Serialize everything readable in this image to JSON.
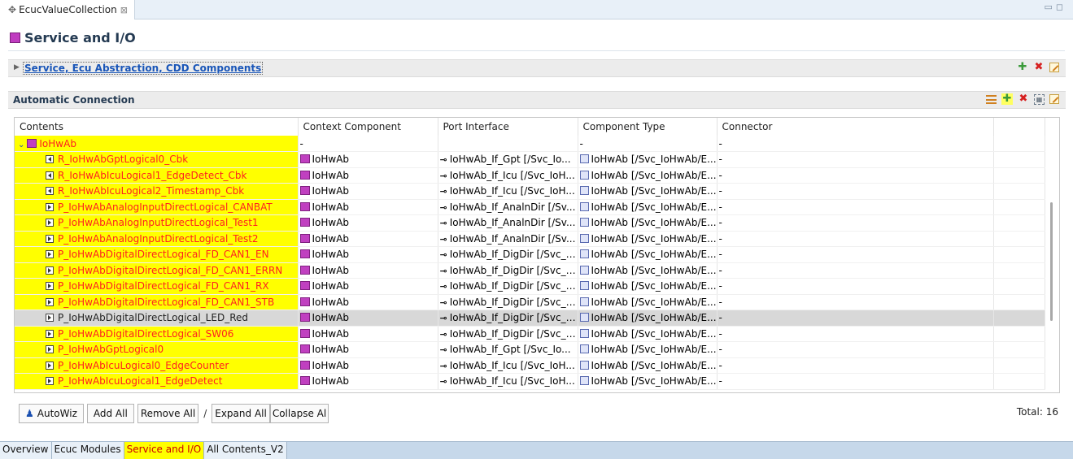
{
  "editor": {
    "tab_title": "EcucValueCollection",
    "tab_close": "⊠"
  },
  "page": {
    "title": "Service and I/O"
  },
  "section_components": {
    "label": "Service, Ecu Abstraction, CDD Components"
  },
  "section_connection": {
    "label": "Automatic Connection"
  },
  "table": {
    "columns": [
      "Contents",
      "Context Component",
      "Port Interface",
      "Component Type",
      "Connector"
    ],
    "root": {
      "label": "IoHwAb",
      "context": "-",
      "interface": "",
      "component_type": "-",
      "connector": "-"
    },
    "rows": [
      {
        "port_kind": "R",
        "name": "R_IoHwAbGptLogical0_Cbk",
        "context": "IoHwAb",
        "interface": "IoHwAb_If_Gpt [/Svc_Io...",
        "component_type": "IoHwAb [/Svc_IoHwAb/E...",
        "connector": "-"
      },
      {
        "port_kind": "R",
        "name": "R_IoHwAbIcuLogical1_EdgeDetect_Cbk",
        "context": "IoHwAb",
        "interface": "IoHwAb_If_Icu [/Svc_IoH...",
        "component_type": "IoHwAb [/Svc_IoHwAb/E...",
        "connector": "-"
      },
      {
        "port_kind": "R",
        "name": "R_IoHwAbIcuLogical2_Timestamp_Cbk",
        "context": "IoHwAb",
        "interface": "IoHwAb_If_Icu [/Svc_IoH...",
        "component_type": "IoHwAb [/Svc_IoHwAb/E...",
        "connector": "-"
      },
      {
        "port_kind": "P",
        "name": "P_IoHwAbAnalogInputDirectLogical_CANBAT",
        "context": "IoHwAb",
        "interface": "IoHwAb_If_AnalnDir [/Sv...",
        "component_type": "IoHwAb [/Svc_IoHwAb/E...",
        "connector": "-"
      },
      {
        "port_kind": "P",
        "name": "P_IoHwAbAnalogInputDirectLogical_Test1",
        "context": "IoHwAb",
        "interface": "IoHwAb_If_AnalnDir [/Sv...",
        "component_type": "IoHwAb [/Svc_IoHwAb/E...",
        "connector": "-"
      },
      {
        "port_kind": "P",
        "name": "P_IoHwAbAnalogInputDirectLogical_Test2",
        "context": "IoHwAb",
        "interface": "IoHwAb_If_AnalnDir [/Sv...",
        "component_type": "IoHwAb [/Svc_IoHwAb/E...",
        "connector": "-"
      },
      {
        "port_kind": "P",
        "name": "P_IoHwAbDigitalDirectLogical_FD_CAN1_EN",
        "context": "IoHwAb",
        "interface": "IoHwAb_If_DigDir [/Svc_I...",
        "component_type": "IoHwAb [/Svc_IoHwAb/E...",
        "connector": "-"
      },
      {
        "port_kind": "P",
        "name": "P_IoHwAbDigitalDirectLogical_FD_CAN1_ERRN",
        "context": "IoHwAb",
        "interface": "IoHwAb_If_DigDir [/Svc_I...",
        "component_type": "IoHwAb [/Svc_IoHwAb/E...",
        "connector": "-"
      },
      {
        "port_kind": "P",
        "name": "P_IoHwAbDigitalDirectLogical_FD_CAN1_RX",
        "context": "IoHwAb",
        "interface": "IoHwAb_If_DigDir [/Svc_I...",
        "component_type": "IoHwAb [/Svc_IoHwAb/E...",
        "connector": "-"
      },
      {
        "port_kind": "P",
        "name": "P_IoHwAbDigitalDirectLogical_FD_CAN1_STB",
        "context": "IoHwAb",
        "interface": "IoHwAb_If_DigDir [/Svc_I...",
        "component_type": "IoHwAb [/Svc_IoHwAb/E...",
        "connector": "-"
      },
      {
        "port_kind": "P",
        "name": "P_IoHwAbDigitalDirectLogical_LED_Red",
        "context": "IoHwAb",
        "interface": "IoHwAb_If_DigDir [/Svc_I...",
        "component_type": "IoHwAb [/Svc_IoHwAb/E...",
        "connector": "-",
        "selected": true
      },
      {
        "port_kind": "P",
        "name": "P_IoHwAbDigitalDirectLogical_SW06",
        "context": "IoHwAb",
        "interface": "IoHwAb_If_DigDir [/Svc_I...",
        "component_type": "IoHwAb [/Svc_IoHwAb/E...",
        "connector": "-"
      },
      {
        "port_kind": "P",
        "name": "P_IoHwAbGptLogical0",
        "context": "IoHwAb",
        "interface": "IoHwAb_If_Gpt [/Svc_Io...",
        "component_type": "IoHwAb [/Svc_IoHwAb/E...",
        "connector": "-"
      },
      {
        "port_kind": "P",
        "name": "P_IoHwAbIcuLogical0_EdgeCounter",
        "context": "IoHwAb",
        "interface": "IoHwAb_If_Icu [/Svc_IoH...",
        "component_type": "IoHwAb [/Svc_IoHwAb/E...",
        "connector": "-"
      },
      {
        "port_kind": "P",
        "name": "P_IoHwAbIcuLogical1_EdgeDetect",
        "context": "IoHwAb",
        "interface": "IoHwAb_If_Icu [/Svc_IoH...",
        "component_type": "IoHwAb [/Svc_IoHwAb/E...",
        "connector": "-"
      }
    ]
  },
  "buttons": {
    "autowiz": "AutoWiz",
    "add_all": "Add All",
    "remove_all": "Remove All",
    "separator": "/",
    "expand_all": "Expand All",
    "collapse_all": "Collapse Al"
  },
  "total": "Total: 16",
  "bottom_tabs": [
    {
      "label": "Overview",
      "active": false
    },
    {
      "label": "Ecuc Modules",
      "active": false
    },
    {
      "label": "Service and I/O",
      "active": true
    },
    {
      "label": "All Contents_V2",
      "active": false
    }
  ],
  "colors": {
    "highlight": "#ffff00",
    "highlight_text": "#ff2020",
    "link": "#1a56b8",
    "selection": "#d8d8d8"
  }
}
